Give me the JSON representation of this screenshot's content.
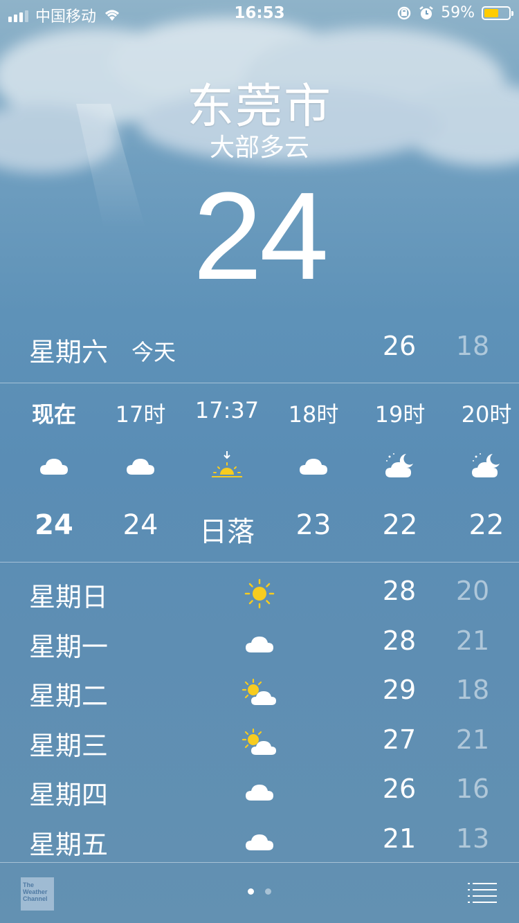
{
  "status_bar": {
    "carrier": "中国移动",
    "time": "16:53",
    "battery_percent": "59%",
    "battery_level": 0.59,
    "icons": [
      "signal-icon",
      "wifi-icon",
      "orientation-lock-icon",
      "alarm-icon",
      "battery-icon"
    ]
  },
  "location": {
    "city": "东莞市",
    "condition": "大部多云",
    "temperature": "24"
  },
  "today": {
    "day": "星期六",
    "label": "今天",
    "high": "26",
    "low": "18"
  },
  "hourly": [
    {
      "time": "现在",
      "icon": "cloud-icon",
      "temp": "24",
      "bold": true
    },
    {
      "time": "17时",
      "icon": "cloud-icon",
      "temp": "24",
      "bold": false
    },
    {
      "time": "17:37",
      "icon": "sunset-icon",
      "temp": "日落",
      "bold": false
    },
    {
      "time": "18时",
      "icon": "cloud-icon",
      "temp": "23",
      "bold": false
    },
    {
      "time": "19时",
      "icon": "night-cloud-icon",
      "temp": "22",
      "bold": false
    },
    {
      "time": "20时",
      "icon": "night-cloud-icon",
      "temp": "22",
      "bold": false
    }
  ],
  "daily": [
    {
      "day": "星期日",
      "icon": "sun-icon",
      "high": "28",
      "low": "20"
    },
    {
      "day": "星期一",
      "icon": "cloud-icon",
      "high": "28",
      "low": "21"
    },
    {
      "day": "星期二",
      "icon": "partly-cloudy-icon",
      "high": "29",
      "low": "18"
    },
    {
      "day": "星期三",
      "icon": "partly-cloudy-icon",
      "high": "27",
      "low": "21"
    },
    {
      "day": "星期四",
      "icon": "cloud-icon",
      "high": "26",
      "low": "16"
    },
    {
      "day": "星期五",
      "icon": "cloud-icon",
      "high": "21",
      "low": "13"
    }
  ],
  "footer": {
    "logo_text": "The Weather Channel",
    "page_count": 2,
    "current_page": 1
  },
  "colors": {
    "sun": "#f7cc1f",
    "battery": "#ffcc00",
    "low_temp": "rgba(255,255,255,0.5)"
  }
}
